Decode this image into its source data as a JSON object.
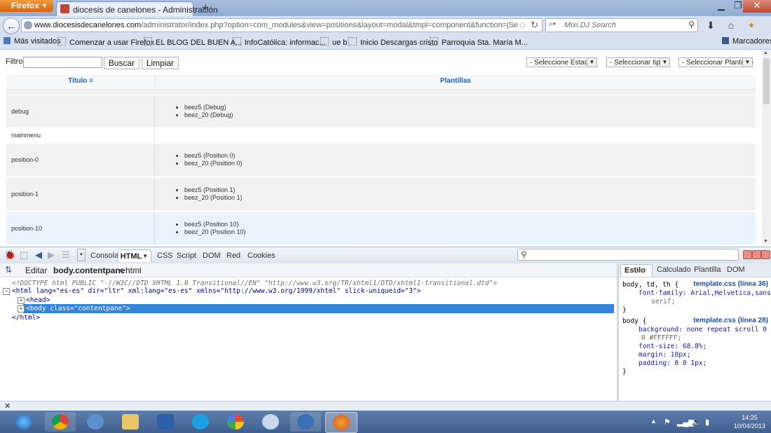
{
  "browser": {
    "app_button": "Firefox",
    "tab_title": "diocesis de canelones - Administración",
    "url_host": "www.diocesisdecanelones.com",
    "url_path": "/administrator/index.php?option=com_modules&view=positions&layout=modal&tmpl=component&function=jSelectPositio",
    "search_placeholder": "Mixi.DJ Search",
    "bookmarks_label": "Marcadores"
  },
  "bookmarks": [
    "Más visitados",
    "Comenzar a usar Firefox",
    "EL BLOG DEL BUEN A...",
    "InfoCatólica: informac...",
    "ue b",
    "Inicio Descargas cristo",
    "Parroquia Sta. María M..."
  ],
  "page": {
    "filter_label": "Filtro:",
    "filter_value": "",
    "search_button": "Buscar",
    "clear_button": "Limpiar",
    "select_state": "- Seleccione Estado -",
    "select_type": "- Seleccionar tipo -",
    "select_template": "- Seleccionar Plantilla -",
    "col_title": "Título",
    "col_templates": "Plantillas",
    "rows": [
      {
        "name": "debug",
        "items": [
          "beez5 (Debug)",
          "beez_20 (Debug)"
        ]
      },
      {
        "name": "mainmenu",
        "items": []
      },
      {
        "name": "position-0",
        "items": [
          "beez5 (Position 0)",
          "beez_20 (Position 0)"
        ]
      },
      {
        "name": "position-1",
        "items": [
          "beez5 (Position 1)",
          "beez_20 (Position 1)"
        ]
      },
      {
        "name": "position-10",
        "items": [
          "beez5 (Position 10)",
          "beez_20 (Position 10)"
        ]
      }
    ]
  },
  "firebug": {
    "tabs": [
      "Consola",
      "HTML",
      "CSS",
      "Script",
      "DOM",
      "Red",
      "Cookies"
    ],
    "edit_label": "Editar",
    "crumb_current": "body.contentpane",
    "crumb_sep": "<",
    "crumb_parent": "html",
    "side_tabs": [
      "Estilo",
      "Calculado",
      "Plantilla",
      "DOM"
    ],
    "html_lines": {
      "doctype": "<!DOCTYPE html PUBLIC \"-//W3C//DTD XHTML 1.0 Transitional//EN\" \"http://www.w3.org/TR/xhtml1/DTD/xhtml1-transitional.dtd\">",
      "html_open": "<html lang=\"es-es\" dir=\"ltr\" xml:lang=\"es-es\" xmlns=\"http://www.w3.org/1999/xhtml\" slick-uniqueid=\"3\">",
      "head": "<head>",
      "body": "<body class=\"contentpane\">",
      "html_close": "</html>"
    },
    "css_rules": [
      {
        "selector": "body, td, th {",
        "source": "template.css (línea 36)",
        "lines": [
          "font-family: Arial,Helvetica,sans-",
          "serif;"
        ],
        "close": "}"
      },
      {
        "selector": "body {",
        "source": "template.css (línea 28)",
        "lines": [
          "background: none repeat scroll 0",
          "0 #FFFFFF;",
          "font-size: 68.8%;",
          "margin: 10px;",
          "padding: 0 0 1px;"
        ],
        "close": "}"
      }
    ]
  },
  "taskbar": {
    "time": "14:25",
    "date": "10/04/2013"
  },
  "colors": {
    "accent_link": "#1b62b4",
    "selected_row": "#3484da",
    "firefox_orange": "#e07a22"
  }
}
